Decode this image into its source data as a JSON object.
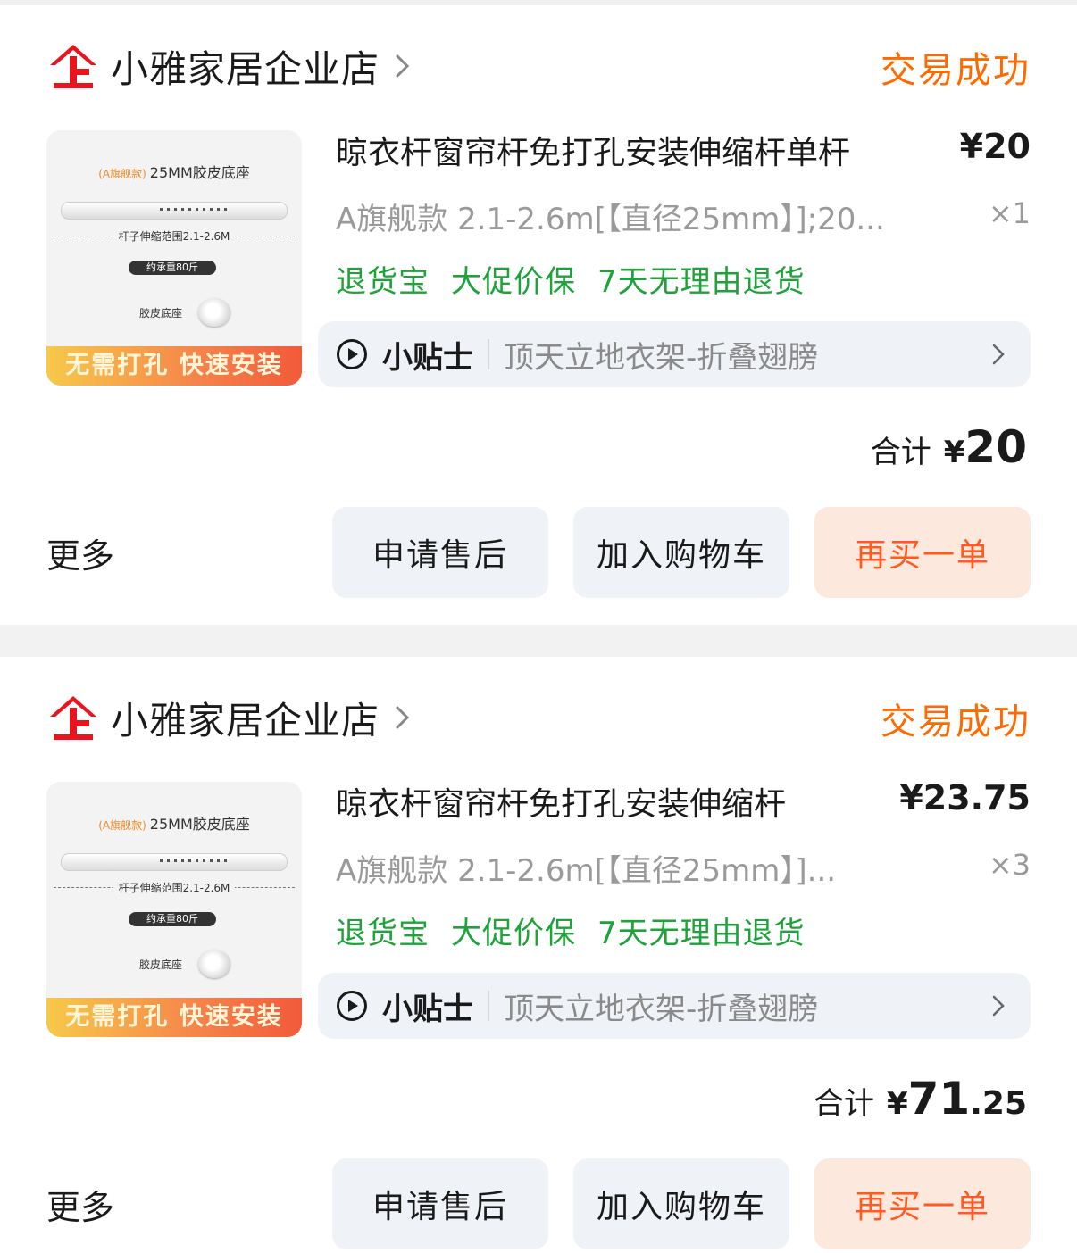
{
  "orders": [
    {
      "store_name": "小雅家居企业店",
      "status": "交易成功",
      "image": {
        "tag": "(A旗舰款)",
        "title": "25MM胶皮底座",
        "range": "杆子伸缩范围2.1-2.6M",
        "load": "约承重80斤",
        "base": "胶皮底座",
        "banner": "无需打孔 快速安装"
      },
      "title": "晾衣杆窗帘杆免打孔安装伸缩杆单杆",
      "price": "¥20",
      "sku": "A旗舰款 2.1-2.6m[【直径25mm】];20...",
      "qty": "×1",
      "services": [
        "退货宝",
        "大促价保",
        "7天无理由退货"
      ],
      "tips_label": "小贴士",
      "tips_text": "顶天立地衣架-折叠翅膀",
      "total_label": "合计",
      "total_yen": "¥",
      "total_int": "20",
      "total_dec": "",
      "more": "更多",
      "btn_after": "申请售后",
      "btn_cart": "加入购物车",
      "btn_rebuy": "再买一单"
    },
    {
      "store_name": "小雅家居企业店",
      "status": "交易成功",
      "image": {
        "tag": "(A旗舰款)",
        "title": "25MM胶皮底座",
        "range": "杆子伸缩范围2.1-2.6M",
        "load": "约承重80斤",
        "base": "胶皮底座",
        "banner": "无需打孔 快速安装"
      },
      "title": "晾衣杆窗帘杆免打孔安装伸缩杆",
      "price": "¥23.75",
      "sku": "A旗舰款 2.1-2.6m[【直径25mm】]...",
      "qty": "×3",
      "services": [
        "退货宝",
        "大促价保",
        "7天无理由退货"
      ],
      "tips_label": "小贴士",
      "tips_text": "顶天立地衣架-折叠翅膀",
      "total_label": "合计",
      "total_yen": "¥",
      "total_int": "71",
      "total_dec": ".25",
      "more": "更多",
      "btn_after": "申请售后",
      "btn_cart": "加入购物车",
      "btn_rebuy": "再买一单"
    }
  ],
  "colors": {
    "status": "#ff6a00",
    "service": "#1ea23a",
    "rebuy_bg": "#fde8de",
    "rebuy_text": "#ff5a1f",
    "logo": "#e8141e"
  },
  "icons": {
    "store_logo": "enterprise-store-icon",
    "chevron": "chevron-right-icon",
    "play": "play-circle-icon"
  }
}
